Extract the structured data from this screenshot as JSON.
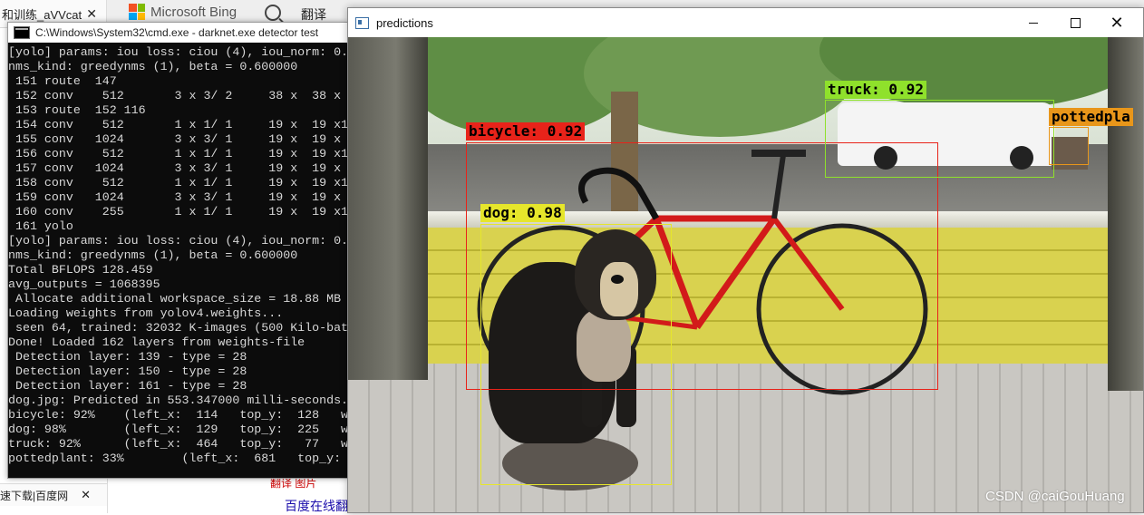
{
  "background_browser": {
    "left_tab_label": "和训练_aVVcat",
    "left_tab_close": "✕",
    "bing_label": "Microsoft Bing",
    "fanyi_label": "翻译",
    "bottom_tab_label": "速下载|百度网",
    "bottom_tab_close": "✕",
    "link_text": "翻译  图片",
    "link_text2": "百度在线翻"
  },
  "cmd": {
    "title": "C:\\Windows\\System32\\cmd.exe - darknet.exe  detector test",
    "lines": [
      "[yolo] params: iou loss: ciou (4), iou_norm: 0.",
      "nms_kind: greedynms (1), beta = 0.600000",
      " 151 route  147",
      " 152 conv    512       3 x 3/ 2     38 x  38 x",
      " 153 route  152 116",
      " 154 conv    512       1 x 1/ 1     19 x  19 x1",
      " 155 conv   1024       3 x 3/ 1     19 x  19 x",
      " 156 conv    512       1 x 1/ 1     19 x  19 x1",
      " 157 conv   1024       3 x 3/ 1     19 x  19 x",
      " 158 conv    512       1 x 1/ 1     19 x  19 x1",
      " 159 conv   1024       3 x 3/ 1     19 x  19 x",
      " 160 conv    255       1 x 1/ 1     19 x  19 x1",
      " 161 yolo",
      "[yolo] params: iou loss: ciou (4), iou_norm: 0.",
      "nms_kind: greedynms (1), beta = 0.600000",
      "Total BFLOPS 128.459",
      "avg_outputs = 1068395",
      " Allocate additional workspace_size = 18.88 MB",
      "Loading weights from yolov4.weights...",
      " seen 64, trained: 32032 K-images (500 Kilo-bat",
      "Done! Loaded 162 layers from weights-file",
      " Detection layer: 139 - type = 28",
      " Detection layer: 150 - type = 28",
      " Detection layer: 161 - type = 28",
      "dog.jpg: Predicted in 553.347000 milli-seconds.",
      "bicycle: 92%    (left_x:  114   top_y:  128   w",
      "dog: 98%        (left_x:  129   top_y:  225   w",
      "truck: 92%      (left_x:  464   top_y:   77   w",
      "pottedplant: 33%        (left_x:  681   top_y:"
    ]
  },
  "predictions_window": {
    "title": "predictions",
    "close_glyph": "✕",
    "watermark": "CSDN @caiGouHuang",
    "detections": [
      {
        "label": "bicycle: 0.92",
        "color": "#e8231a"
      },
      {
        "label": "dog: 0.98",
        "color": "#e6e62b"
      },
      {
        "label": "truck: 0.92",
        "color": "#8fe12b"
      },
      {
        "label": "pottedpla",
        "color": "#e8961a"
      }
    ]
  }
}
